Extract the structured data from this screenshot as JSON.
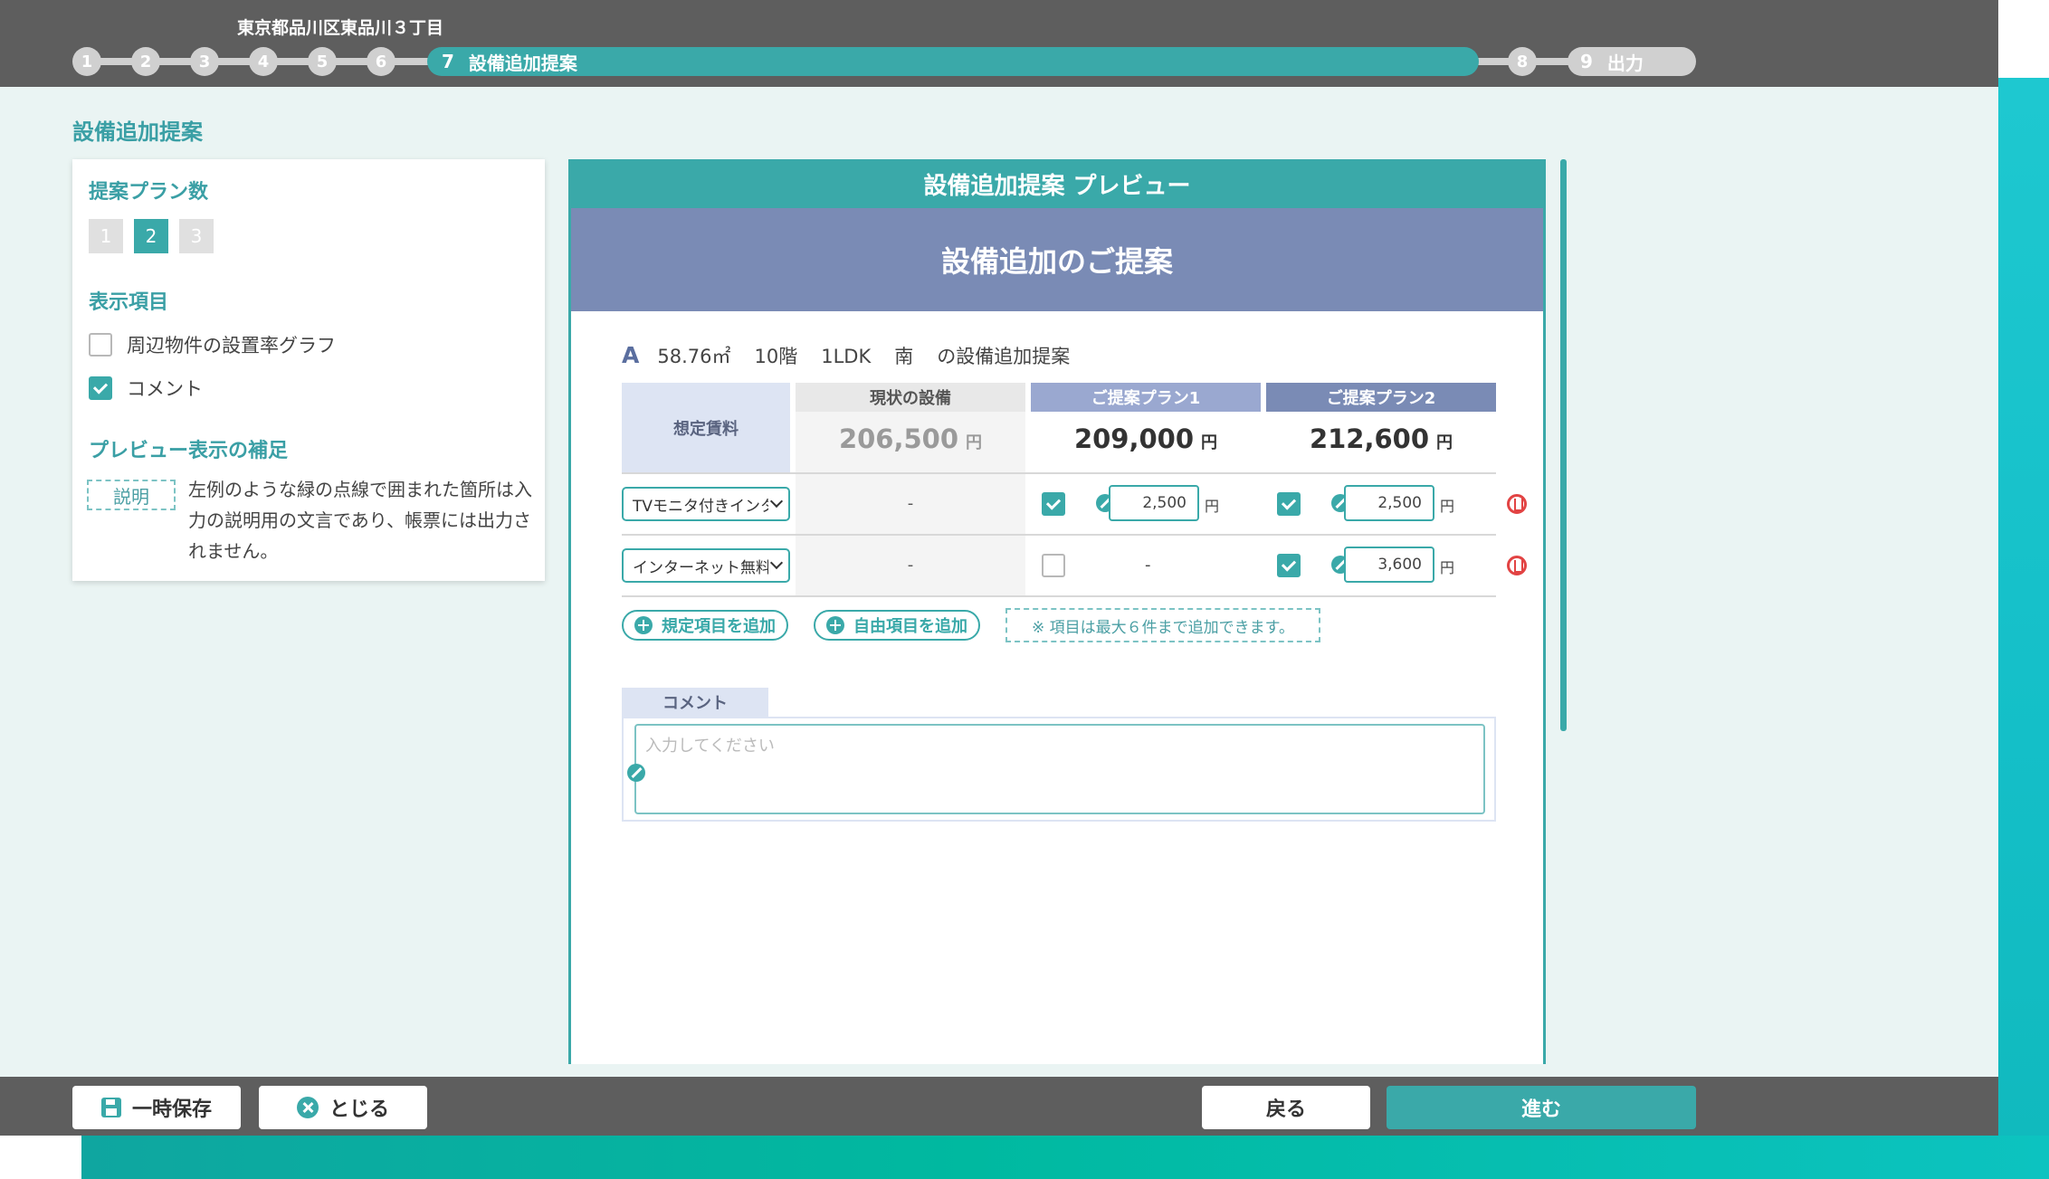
{
  "header": {
    "address": "東京都品川区東品川３丁目",
    "steps": [
      {
        "num": "1"
      },
      {
        "num": "2"
      },
      {
        "num": "3"
      },
      {
        "num": "4"
      },
      {
        "num": "5"
      },
      {
        "num": "6"
      }
    ],
    "active_step": {
      "num": "7",
      "label": "設備追加提案"
    },
    "step8": {
      "num": "8"
    },
    "step9": {
      "num": "9",
      "label": "出力"
    }
  },
  "left_panel": {
    "page_title": "設備追加提案",
    "plan_count": {
      "title": "提案プラン数",
      "options": [
        "1",
        "2",
        "3"
      ],
      "selected": "2"
    },
    "display_items": {
      "title": "表示項目",
      "items": [
        {
          "label": "周辺物件の設置率グラフ",
          "checked": false
        },
        {
          "label": "コメント",
          "checked": true
        }
      ]
    },
    "preview_note": {
      "title": "プレビュー表示の補足",
      "sample": "説明",
      "text": "左例のような緑の点線で囲まれた箇所は入力の説明用の文言であり、帳票には出力されません。"
    }
  },
  "preview": {
    "header": "設備追加提案 プレビュー",
    "banner": "設備追加のご提案",
    "info": {
      "letter": "A",
      "area": "58.76㎡",
      "floor": "10階",
      "layout": "1LDK",
      "direction": "南",
      "suffix": "の設備追加提案"
    },
    "rent_label": "想定賃料",
    "columns": {
      "current": "現状の設備",
      "plan1": "ご提案プラン1",
      "plan2": "ご提案プラン2"
    },
    "prices": {
      "current": "206,500",
      "plan1": "209,000",
      "plan2": "212,600",
      "unit": "円"
    },
    "items": [
      {
        "select": "TVモニタ付きインターホン",
        "current": "-",
        "plan1_checked": true,
        "plan1_amount": "2,500",
        "plan2_checked": true,
        "plan2_amount": "2,500",
        "unit": "円"
      },
      {
        "select": "インターネット無料",
        "current": "-",
        "plan1_checked": false,
        "plan1_value": "-",
        "plan2_checked": true,
        "plan2_amount": "3,600",
        "unit": "円"
      }
    ],
    "buttons": {
      "add_standard": "規定項目を追加",
      "add_free": "自由項目を追加"
    },
    "note": "※ 項目は最大６件まで追加できます。",
    "comment": {
      "label": "コメント",
      "placeholder": "入力してください"
    }
  },
  "footer": {
    "save": "一時保存",
    "close": "とじる",
    "back": "戻る",
    "next": "進む"
  },
  "colors": {
    "accent": "#3aa9a9",
    "plan1": "#9aa8d0",
    "plan2": "#7a8bb5",
    "delete": "#e24343",
    "topbar": "#5e5e5e"
  }
}
